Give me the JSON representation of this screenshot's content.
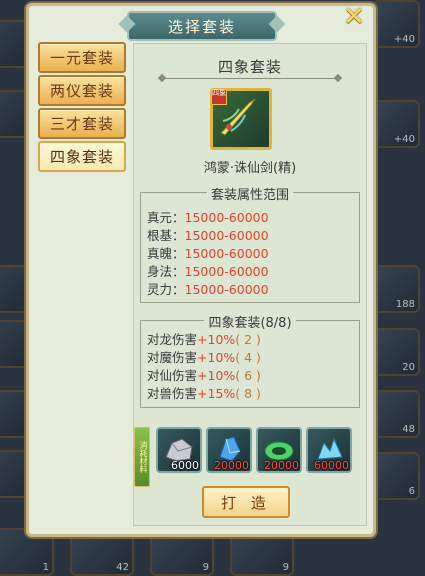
{
  "dialog": {
    "title": "选择套装",
    "close_icon": "close-x-icon"
  },
  "tabs": [
    {
      "label": "一元套装",
      "active": false
    },
    {
      "label": "两仪套装",
      "active": false
    },
    {
      "label": "三才套装",
      "active": false
    },
    {
      "label": "四象套装",
      "active": true
    }
  ],
  "detail": {
    "set_name": "四象套装",
    "item_icon": "sword-icon",
    "item_badge": "四象",
    "item_name": "鸿蒙·诛仙剑(精)",
    "attributes": {
      "title": "套装属性范围",
      "rows": [
        {
          "name": "真元：",
          "value": "15000-60000"
        },
        {
          "name": "根基：",
          "value": "15000-60000"
        },
        {
          "name": "真魄：",
          "value": "15000-60000"
        },
        {
          "name": "身法：",
          "value": "15000-60000"
        },
        {
          "name": "灵力：",
          "value": "15000-60000"
        }
      ]
    },
    "set_bonus": {
      "title": "四象套装(8/8)",
      "rows": [
        {
          "name": "对龙伤害",
          "value": "+10%",
          "level": "( 2 )"
        },
        {
          "name": "对魔伤害",
          "value": "+10%",
          "level": "( 4 )"
        },
        {
          "name": "对仙伤害",
          "value": "+10%",
          "level": "( 6 )"
        },
        {
          "name": "对兽伤害",
          "value": "+15%",
          "level": "( 8 )"
        }
      ]
    }
  },
  "materials": {
    "label": "消耗材料",
    "items": [
      {
        "icon": "silver-ore-icon",
        "count": "6000",
        "insufficient": false
      },
      {
        "icon": "blue-crystal-icon",
        "count": "20000",
        "insufficient": true
      },
      {
        "icon": "green-jade-icon",
        "count": "20000",
        "insufficient": true
      },
      {
        "icon": "ice-crystal-icon",
        "count": "60000",
        "insufficient": true
      }
    ]
  },
  "craft_button": {
    "label": "打 造"
  },
  "background": {
    "counts": [
      "+40",
      "+40",
      "188",
      "20",
      "48",
      "6",
      "1",
      "42",
      "9",
      "9"
    ]
  }
}
